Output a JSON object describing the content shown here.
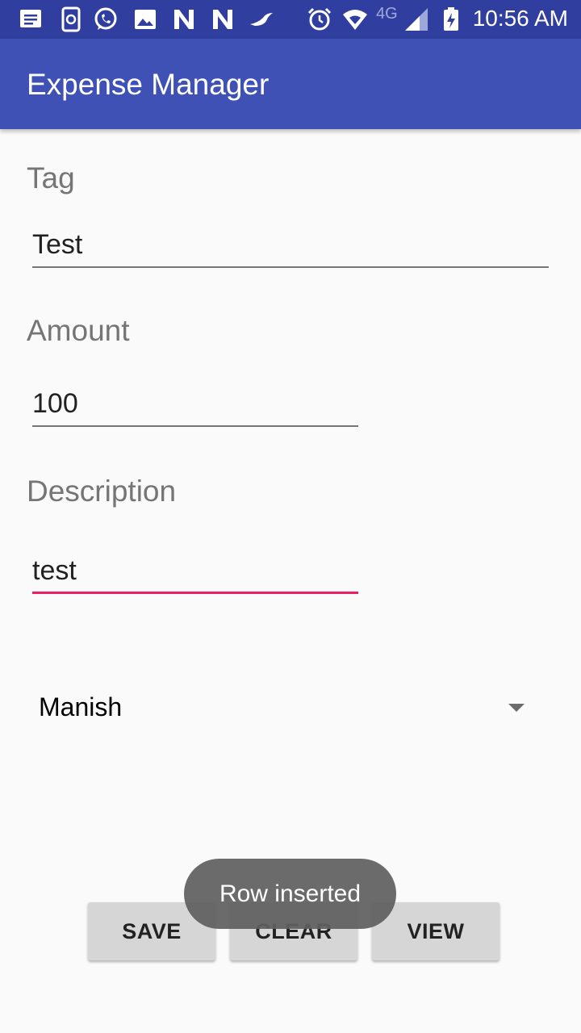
{
  "status_bar": {
    "time": "10:56 AM",
    "network": "4G",
    "icons": [
      "message-icon",
      "phone-sync-icon",
      "whatsapp-icon",
      "image-icon",
      "n-icon",
      "n-icon",
      "bird-icon",
      "alarm-icon",
      "wifi-icon",
      "signal-icon",
      "battery-charging-icon"
    ]
  },
  "app_bar": {
    "title": "Expense Manager"
  },
  "form": {
    "tag_label": "Tag",
    "tag_value": "Test",
    "amount_label": "Amount",
    "amount_value": "100",
    "description_label": "Description",
    "description_value": "test",
    "spinner_value": "Manish"
  },
  "buttons": {
    "save": "SAVE",
    "clear": "CLEAR",
    "view": "VIEW"
  },
  "toast": {
    "message": "Row inserted"
  },
  "colors": {
    "primary": "#3f51b5",
    "primary_dark": "#303f9f",
    "accent": "#e91e63",
    "button": "#d6d6d6"
  }
}
